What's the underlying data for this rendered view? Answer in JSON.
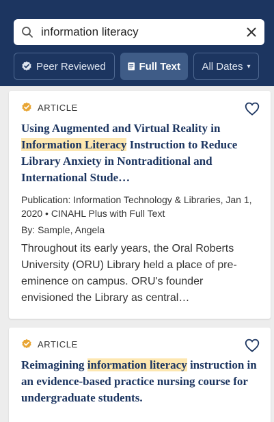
{
  "search": {
    "value": "information literacy"
  },
  "filters": [
    {
      "label": "Peer Reviewed"
    },
    {
      "label": "Full Text"
    },
    {
      "label": "All Dates",
      "caret": "▾"
    }
  ],
  "results": [
    {
      "type": "ARTICLE",
      "title_parts": [
        "Using Augmented and Virtual Reality in ",
        "Information Literacy",
        " Instruction to Reduce Library Anxiety in Nontraditional and International Stude…"
      ],
      "publication_label": "Publication:",
      "publication": "Information Technology & Libraries, Jan 1, 2020",
      "source": "• CINAHL Plus with Full Text",
      "by_label": "By:",
      "author": "Sample, Angela",
      "abstract": "Throughout its early years, the Oral Roberts University (ORU) Library held a place of pre-eminence on campus. ORU's founder envisioned the Library as central…"
    },
    {
      "type": "ARTICLE",
      "title_parts": [
        "Reimagining ",
        "information literacy",
        " instruction in an evidence-based practice nursing course for undergraduate students."
      ]
    }
  ],
  "colors": {
    "header": "#1c3560",
    "highlight": "#fde7b0",
    "badge": "#e8a533",
    "link": "#1c3560"
  }
}
